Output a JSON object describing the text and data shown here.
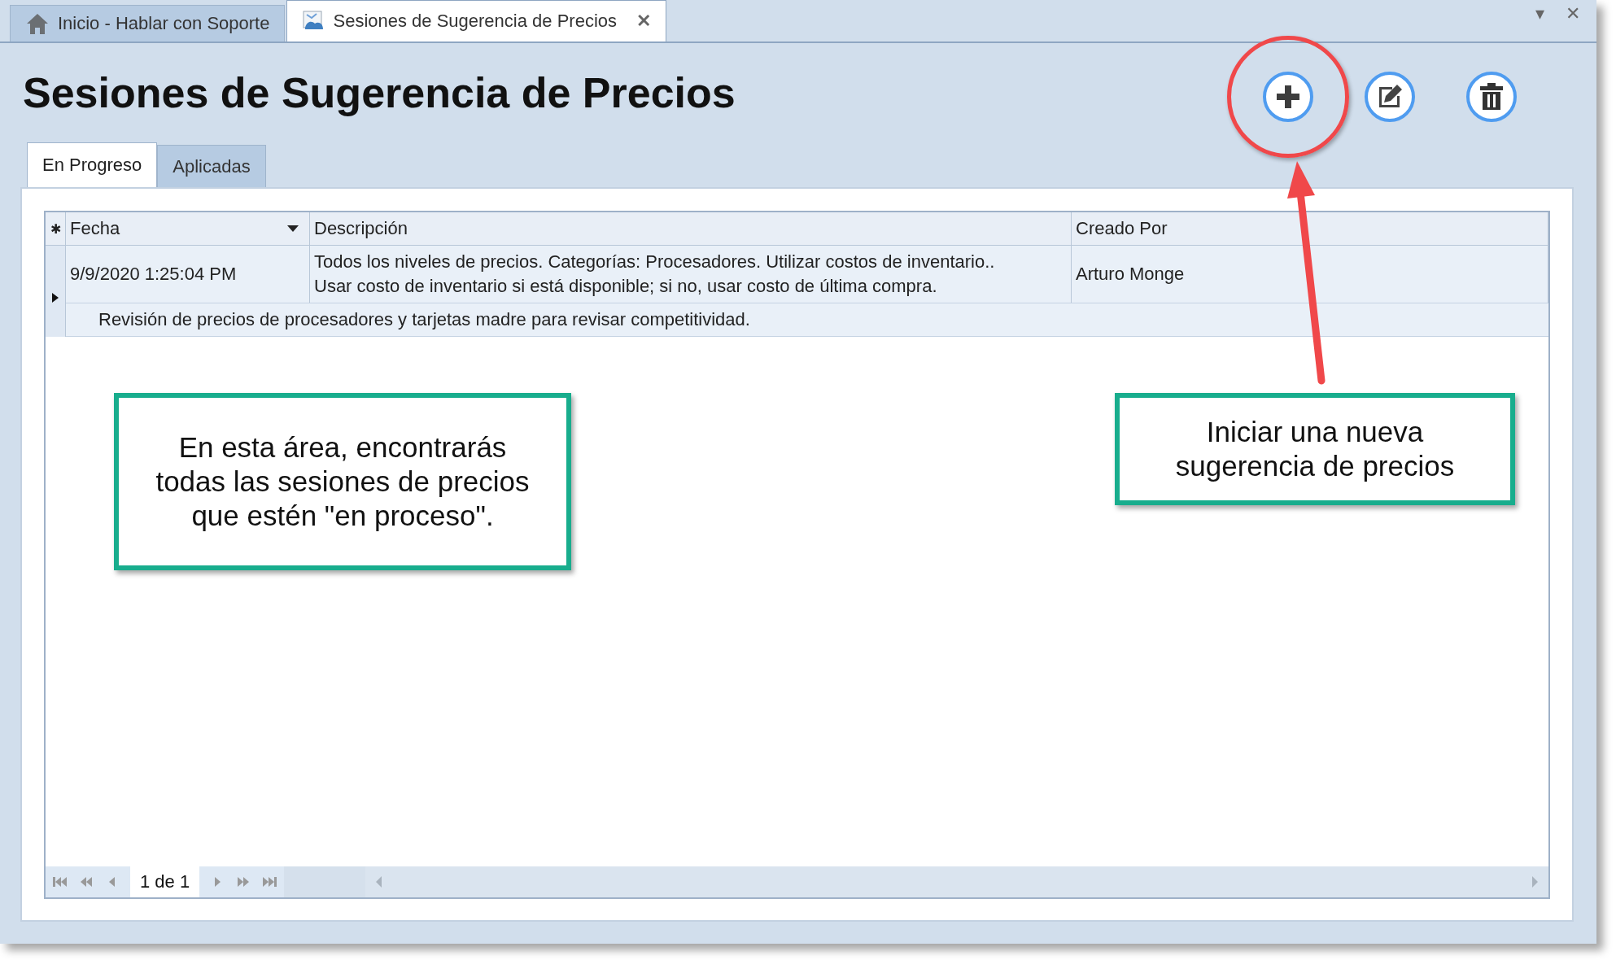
{
  "doc_tabs": [
    {
      "kind": "home",
      "label": "Inicio - Hablar con Soporte",
      "selected": false
    },
    {
      "kind": "document",
      "label": "Sesiones de Sugerencia de Precios",
      "selected": true,
      "close": "✕"
    }
  ],
  "window_controls": [
    "▾",
    "✕"
  ],
  "title": "Sesiones de Sugerencia de Precios",
  "toolbar": [
    {
      "kind": "add",
      "highlighted": true
    },
    {
      "kind": "edit",
      "highlighted": false
    },
    {
      "kind": "delete",
      "highlighted": false
    }
  ],
  "tabs": [
    {
      "label": "En Progreso",
      "selected": true
    },
    {
      "label": "Aplicadas",
      "selected": false
    }
  ],
  "grid": {
    "new_row_glyph": "✱",
    "columns": [
      {
        "label": "Fecha",
        "sortable": true
      },
      {
        "label": "Descripción",
        "sortable": false
      },
      {
        "label": "Creado Por",
        "sortable": false
      }
    ],
    "rows": [
      {
        "current": true,
        "date": "9/9/2020 1:25:04 PM",
        "description_lines": [
          "Todos los niveles de precios. Categorías: Procesadores. Utilizar costos de inventario..",
          "Usar costo de inventario si está disponible; si no, usar costo de última compra."
        ],
        "created_by": "Arturo Monge",
        "preview": "Revisión de precios de procesadores y tarjetas madre para revisar competitividad."
      }
    ],
    "pager": "1 de 1"
  },
  "callouts": [
    {
      "text": "En esta área, encontrarás todas las sesiones de precios que estén \"en proceso\"."
    },
    {
      "text": "Iniciar una nueva sugerencia de precios"
    }
  ]
}
